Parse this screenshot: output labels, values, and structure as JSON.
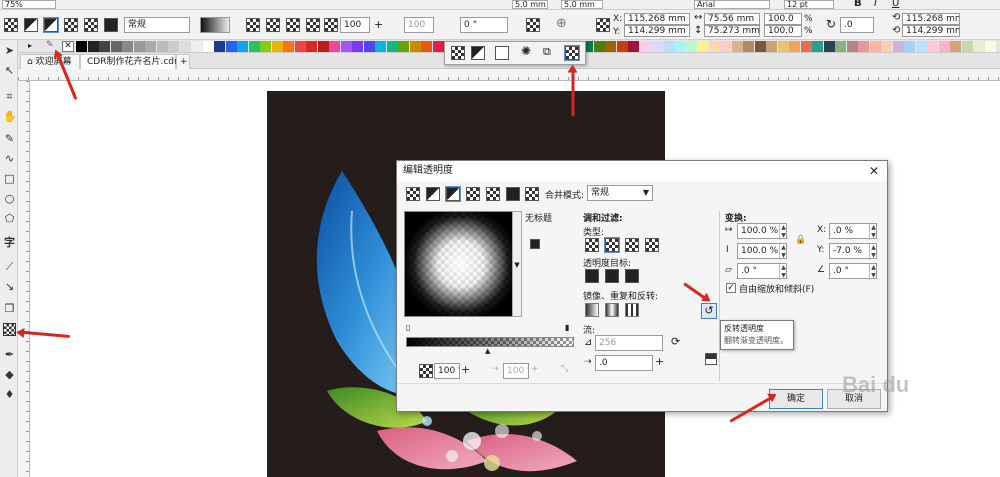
{
  "top_row": {
    "zoom": "75%",
    "mm1": "5.0 mm",
    "mm2": "5.0 mm",
    "font": "Arial",
    "font_size": "12 pt",
    "bold": "B",
    "italic": "I",
    "underline": "U"
  },
  "propbar": {
    "merge_mode": "常规",
    "opacity": "100",
    "opacity_b": "100",
    "angle": "0 °",
    "x": "115.268 mm",
    "y": "114.299 mm",
    "w": "75.56 mm",
    "h": "75.273 mm",
    "sx": "100.0",
    "sy": "100.0",
    "pct": "%",
    "rot": ".0",
    "cx": "115.268 mm",
    "cy": "114.299 mm",
    "x_label": "X:",
    "y_label": "Y:"
  },
  "tabs": {
    "welcome": "欢迎屏幕",
    "doc": "CDR制作花卉名片.cdr",
    "add": "+"
  },
  "dialog": {
    "title": "编辑透明度",
    "close": "✕",
    "merge_label": "合并模式:",
    "merge_value": "常规",
    "preset_name": "无标题",
    "node_opacity": "100 %",
    "node_pos": "100 %",
    "section_blend": "调和过滤:",
    "type_label": "类型:",
    "target_label": "透明度目标:",
    "mirror_label": "镜像、重复和反转:",
    "flow_label": "流:",
    "steps": "256",
    "accel": ".0",
    "section_transform": "变换:",
    "scale_w": "100.0 %",
    "scale_h": "100.0 %",
    "skew": ".0 °",
    "rotate": ".0 °",
    "tx_label": "X:",
    "tx": ".0 %",
    "ty_label": "Y:",
    "ty": "-7.0 %",
    "free_scale_label": "自由缩放和倾斜(F)",
    "ok": "确定",
    "cancel": "取消"
  },
  "tooltip": {
    "title": "反转透明度",
    "desc": "翻转渐变透明度。"
  },
  "watermark": "Bai du",
  "colors": {
    "accent_arrow": "#d7261c",
    "page_bg": "#251d1b"
  }
}
